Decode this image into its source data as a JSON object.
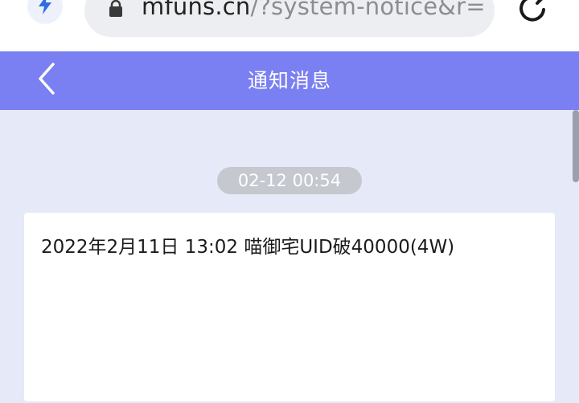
{
  "browser": {
    "url_host": "mfuns.cn",
    "url_rest": "/?system-notice&r=ll",
    "icons": {
      "quick": "lightning-bolt-icon",
      "lock": "lock-icon",
      "reload": "reload-icon"
    }
  },
  "header": {
    "title": "通知消息",
    "back_icon": "chevron-left-icon",
    "background": "#7a7ff2"
  },
  "notice": {
    "timestamp": "02-12 00:54",
    "text": "2022年2月11日 13:02 喵御宅UID破40000(4W)"
  },
  "colors": {
    "page_background": "#e6e9f7",
    "badge_background": "#c6c8d0",
    "card_background": "#ffffff"
  }
}
